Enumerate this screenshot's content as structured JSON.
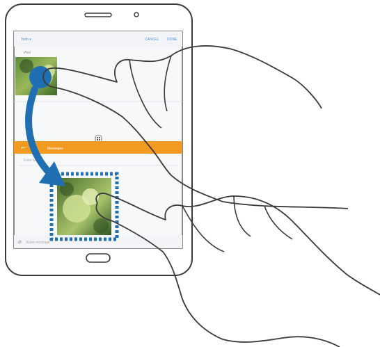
{
  "top_pane": {
    "folder_label": "Todo",
    "caret": "▾",
    "actions": [
      "CANCEL",
      "DONE"
    ],
    "caption": "Wed",
    "photo_icon": "flower-photo-icon"
  },
  "bottom_pane": {
    "back_icon": "arrow-left-icon",
    "title": "Messages",
    "compose_placeholder": "Enter message",
    "message_hint": "Enter text",
    "attach_icon": "paperclip-icon",
    "photo_icon": "flower-photo-icon"
  },
  "divider_icon": "split-view-handle-icon",
  "colors": {
    "accent_orange": "#f39a21",
    "drag_blue": "#1f6fb2",
    "outline": "#3a3a3a"
  }
}
